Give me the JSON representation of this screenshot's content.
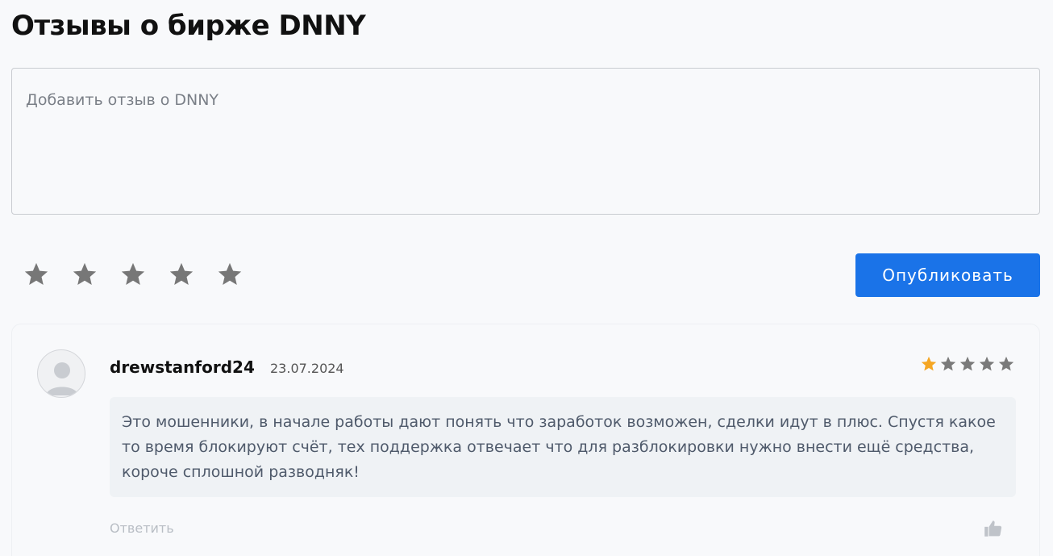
{
  "header": {
    "title": "Отзывы о бирже DNNY"
  },
  "form": {
    "placeholder": "Добавить отзыв о DNNY",
    "rating_value": 0,
    "rating_max": 5,
    "publish_label": "Опубликовать"
  },
  "reviews": [
    {
      "author": "drewstanford24",
      "date": "23.07.2024",
      "rating": 1,
      "rating_max": 5,
      "text": "Это мошенники, в начале работы дают понять что заработок возможен, сделки идут в плюс. Спустя какое то время блокируют счёт, тех поддержка отвечает что для разблокировки нужно внести ещё средства, короче сплошной разводняк!",
      "reply_label": "Ответить"
    }
  ],
  "colors": {
    "accent": "#1a73e8",
    "star_active": "#f5a623",
    "star_inactive": "#7a7a7a"
  },
  "icons": {
    "star": "star-icon",
    "avatar": "user-avatar-icon",
    "like": "thumbs-up-icon"
  }
}
